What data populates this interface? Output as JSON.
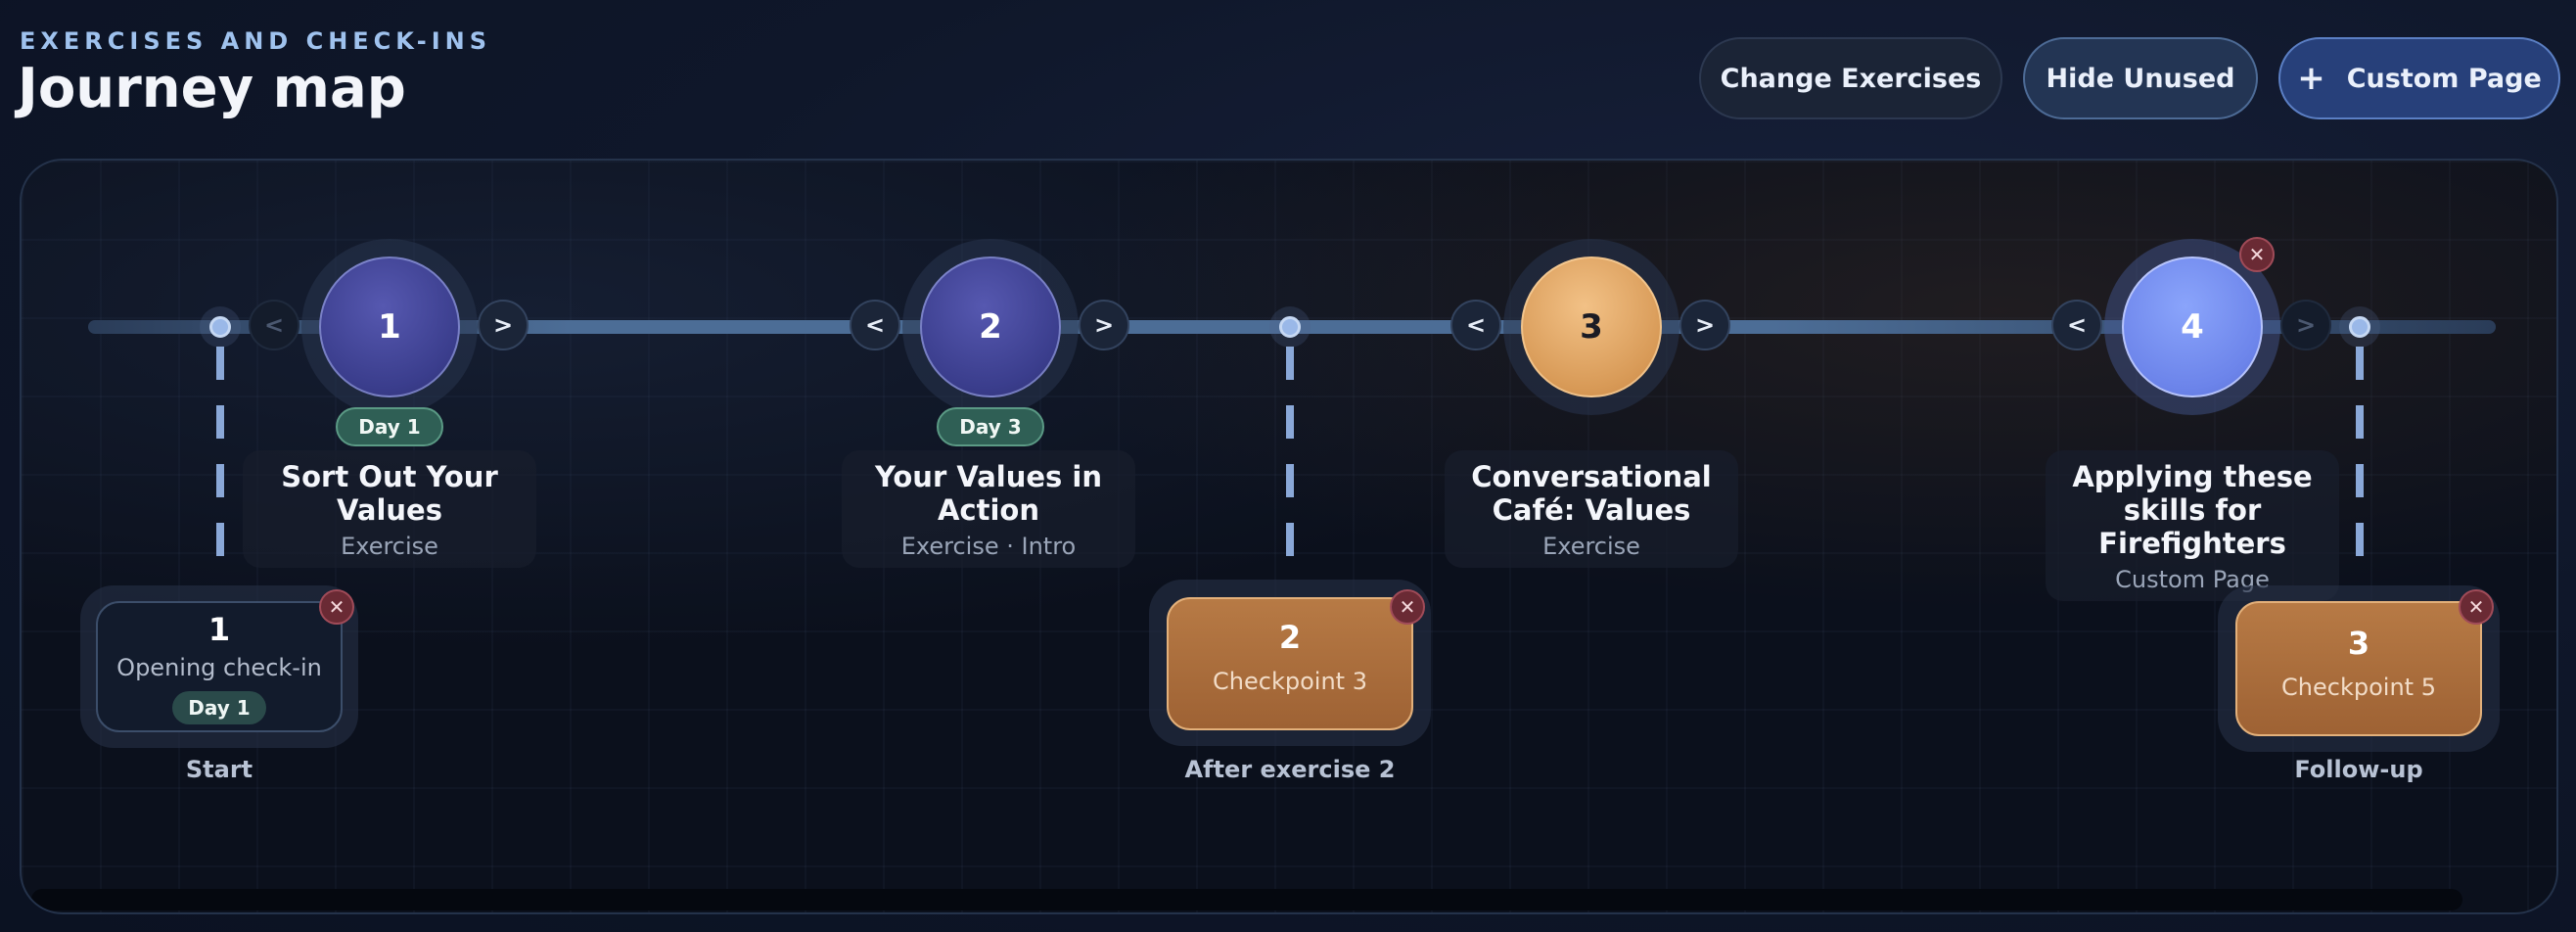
{
  "header": {
    "eyebrow": "EXERCISES AND CHECK-INS",
    "title": "Journey map"
  },
  "toolbar": {
    "change_label": "Change Exercises",
    "hide_label": "Hide Unused",
    "custom_plus": "+",
    "custom_label": "Custom Page"
  },
  "arrows": {
    "prev": "<",
    "next": ">"
  },
  "close_glyph": "✕",
  "exercises": [
    {
      "number": "1",
      "day": "Day 1",
      "title": "Sort Out Your Values",
      "subtitle": "Exercise",
      "color": "#3a3d8c"
    },
    {
      "number": "2",
      "day": "Day 3",
      "title": "Your Values in Action",
      "subtitle": "Exercise · Intro",
      "color": "#3a3d8c"
    },
    {
      "number": "3",
      "title": "Conversational Café: Values",
      "subtitle": "Exercise",
      "color": "#d89a57"
    },
    {
      "number": "4",
      "title": "Applying these skills for Firefighters",
      "subtitle": "Custom Page",
      "color": "#6c84ea"
    }
  ],
  "checkpoints": [
    {
      "number": "1",
      "label": "Opening check-in",
      "day": "Day 1",
      "caption": "Start"
    },
    {
      "number": "2",
      "label": "Checkpoint 3",
      "caption": "After exercise 2"
    },
    {
      "number": "3",
      "label": "Checkpoint 5",
      "caption": "Follow-up"
    }
  ]
}
